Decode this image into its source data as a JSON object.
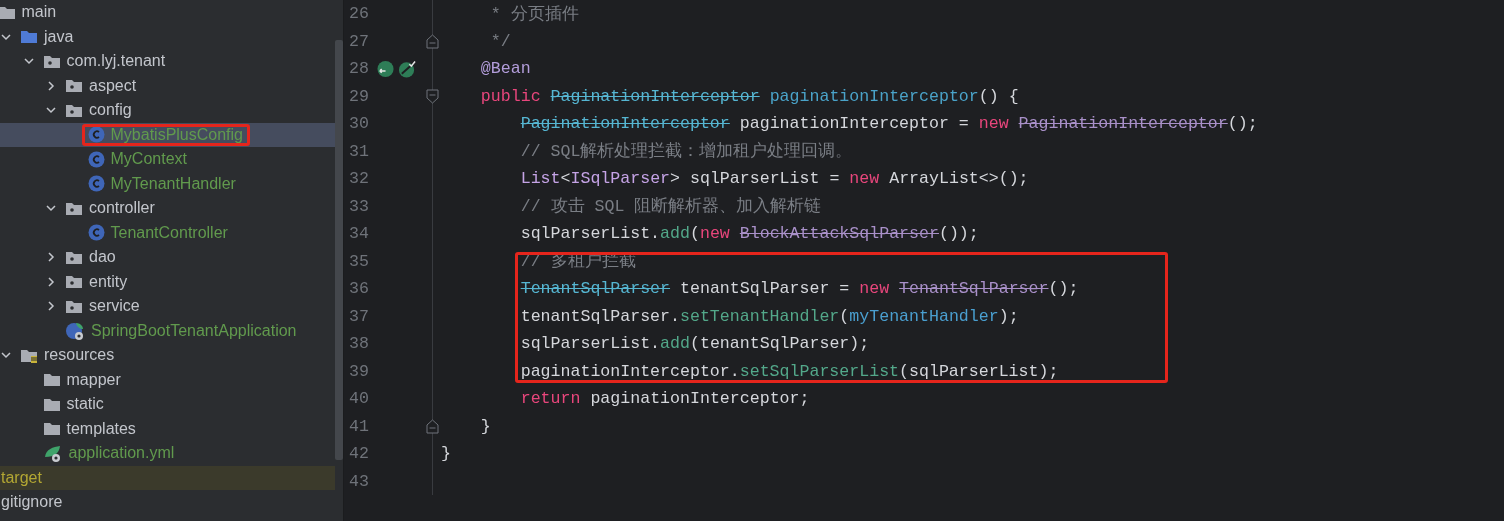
{
  "tree": [
    {
      "label": "main",
      "kind": "folder",
      "selected": false,
      "children": [
        {
          "label": "java",
          "kind": "source-folder",
          "expanded": true,
          "selected": false,
          "children": [
            {
              "label": "com.lyj.tenant",
              "kind": "package",
              "expanded": true,
              "selected": false,
              "children": [
                {
                  "label": "aspect",
                  "kind": "package",
                  "expanded": false,
                  "selected": false
                },
                {
                  "label": "config",
                  "kind": "package",
                  "expanded": true,
                  "selected": false,
                  "children": [
                    {
                      "label": "MybatisPlusConfig",
                      "kind": "class",
                      "selected": true,
                      "highlighted": true,
                      "color": "#619a4d"
                    },
                    {
                      "label": "MyContext",
                      "kind": "class",
                      "selected": false,
                      "highlighted": false,
                      "color": "#619a4d"
                    },
                    {
                      "label": "MyTenantHandler",
                      "kind": "class",
                      "selected": false,
                      "highlighted": false,
                      "color": "#619a4d"
                    }
                  ]
                },
                {
                  "label": "controller",
                  "kind": "package",
                  "expanded": true,
                  "selected": false,
                  "children": [
                    {
                      "label": "TenantController",
                      "kind": "class",
                      "selected": false,
                      "highlighted": false,
                      "color": "#619a4d"
                    }
                  ]
                },
                {
                  "label": "dao",
                  "kind": "package",
                  "expanded": false,
                  "selected": false
                },
                {
                  "label": "entity",
                  "kind": "package",
                  "expanded": false,
                  "selected": false
                },
                {
                  "label": "service",
                  "kind": "package",
                  "expanded": false,
                  "selected": false
                },
                {
                  "label": "SpringBootTenantApplication",
                  "kind": "spring-app",
                  "selected": false,
                  "color": "#619a4d"
                }
              ]
            }
          ]
        },
        {
          "label": "resources",
          "kind": "resources-folder",
          "expanded": true,
          "selected": false,
          "children": [
            {
              "label": "mapper",
              "kind": "folder",
              "selected": false
            },
            {
              "label": "static",
              "kind": "folder",
              "selected": false
            },
            {
              "label": "templates",
              "kind": "folder",
              "selected": false
            },
            {
              "label": "application.yml",
              "kind": "yaml",
              "selected": false,
              "color": "#619a4d"
            }
          ]
        }
      ]
    },
    {
      "label": "target",
      "kind": "excluded",
      "selected": false,
      "color": "#b3a733"
    },
    {
      "label": "gitignore",
      "kind": "file",
      "selected": false
    }
  ],
  "editor": {
    "lines": [
      {
        "number": "26",
        "kind": "plain",
        "highlighted": false,
        "tokens": [
          {
            "text": "     * 分页插件",
            "kind": "comment"
          }
        ]
      },
      {
        "number": "27",
        "kind": "fold-end",
        "highlighted": false,
        "tokens": [
          {
            "text": "     */",
            "kind": "comment"
          }
        ]
      },
      {
        "number": "28",
        "kind": "bean",
        "highlighted": false,
        "tokens": [
          {
            "text": "    @Bean",
            "kind": "annotation"
          }
        ]
      },
      {
        "number": "29",
        "kind": "fold-start",
        "highlighted": false,
        "tokens": [
          {
            "text": "    public",
            "kind": "keyword"
          },
          {
            "text": " PaginationInterceptor",
            "kind": "deprecated-type"
          },
          {
            "text": " paginationInterceptor",
            "kind": "method-decl"
          },
          {
            "text": "() {",
            "kind": "plain"
          }
        ]
      },
      {
        "number": "30",
        "kind": "plain",
        "highlighted": false,
        "tokens": [
          {
            "text": "        PaginationInterceptor",
            "kind": "deprecated-type"
          },
          {
            "text": " paginationInterceptor = ",
            "kind": "plain"
          },
          {
            "text": "new",
            "kind": "keyword"
          },
          {
            "text": " PaginationInterceptor",
            "kind": "deprecated-ctor"
          },
          {
            "text": "();",
            "kind": "plain"
          }
        ]
      },
      {
        "number": "31",
        "kind": "plain",
        "highlighted": false,
        "tokens": [
          {
            "text": "        // SQL解析处理拦截：增加租户处理回调。",
            "kind": "comment"
          }
        ]
      },
      {
        "number": "32",
        "kind": "plain",
        "highlighted": false,
        "tokens": [
          {
            "text": "        List",
            "kind": "type"
          },
          {
            "text": "<",
            "kind": "plain"
          },
          {
            "text": "ISqlParser",
            "kind": "type"
          },
          {
            "text": "> sqlParserList = ",
            "kind": "plain"
          },
          {
            "text": "new",
            "kind": "keyword"
          },
          {
            "text": " ArrayList<>();",
            "kind": "plain"
          }
        ]
      },
      {
        "number": "33",
        "kind": "plain",
        "highlighted": false,
        "tokens": [
          {
            "text": "        // 攻击 SQL 阻断解析器、加入解析链",
            "kind": "comment"
          }
        ]
      },
      {
        "number": "34",
        "kind": "plain",
        "highlighted": false,
        "tokens": [
          {
            "text": "        sqlParserList.",
            "kind": "plain"
          },
          {
            "text": "add",
            "kind": "method"
          },
          {
            "text": "(",
            "kind": "plain"
          },
          {
            "text": "new",
            "kind": "keyword"
          },
          {
            "text": " BlockAttackSqlParser",
            "kind": "deprecated-ctor"
          },
          {
            "text": "());",
            "kind": "plain"
          }
        ]
      },
      {
        "number": "35",
        "kind": "plain",
        "highlighted": true,
        "tokens": [
          {
            "text": "        // 多租户拦截",
            "kind": "comment"
          }
        ]
      },
      {
        "number": "36",
        "kind": "plain",
        "highlighted": true,
        "tokens": [
          {
            "text": "        TenantSqlParser",
            "kind": "deprecated-type"
          },
          {
            "text": " tenantSqlParser = ",
            "kind": "plain"
          },
          {
            "text": "new",
            "kind": "keyword"
          },
          {
            "text": " TenantSqlParser",
            "kind": "deprecated-ctor"
          },
          {
            "text": "();",
            "kind": "plain"
          }
        ]
      },
      {
        "number": "37",
        "kind": "plain",
        "highlighted": true,
        "tokens": [
          {
            "text": "        tenantSqlParser.",
            "kind": "plain"
          },
          {
            "text": "setTenantHandler",
            "kind": "method"
          },
          {
            "text": "(",
            "kind": "plain"
          },
          {
            "text": "myTenantHandler",
            "kind": "field"
          },
          {
            "text": ");",
            "kind": "plain"
          }
        ]
      },
      {
        "number": "38",
        "kind": "plain",
        "highlighted": true,
        "tokens": [
          {
            "text": "        sqlParserList.",
            "kind": "plain"
          },
          {
            "text": "add",
            "kind": "method"
          },
          {
            "text": "(tenantSqlParser);",
            "kind": "plain"
          }
        ]
      },
      {
        "number": "39",
        "kind": "plain",
        "highlighted": true,
        "tokens": [
          {
            "text": "        paginationInterceptor.",
            "kind": "plain"
          },
          {
            "text": "setSqlParserList",
            "kind": "method"
          },
          {
            "text": "(sqlParserList);",
            "kind": "plain"
          }
        ]
      },
      {
        "number": "40",
        "kind": "plain",
        "highlighted": false,
        "tokens": [
          {
            "text": "        return",
            "kind": "keyword"
          },
          {
            "text": " paginationInterceptor;",
            "kind": "plain"
          }
        ]
      },
      {
        "number": "41",
        "kind": "fold-end",
        "highlighted": false,
        "tokens": [
          {
            "text": "    }",
            "kind": "plain"
          }
        ]
      },
      {
        "number": "42",
        "kind": "plain",
        "highlighted": false,
        "tokens": [
          {
            "text": "}",
            "kind": "plain"
          }
        ]
      },
      {
        "number": "43",
        "kind": "plain",
        "highlighted": false
      }
    ]
  }
}
